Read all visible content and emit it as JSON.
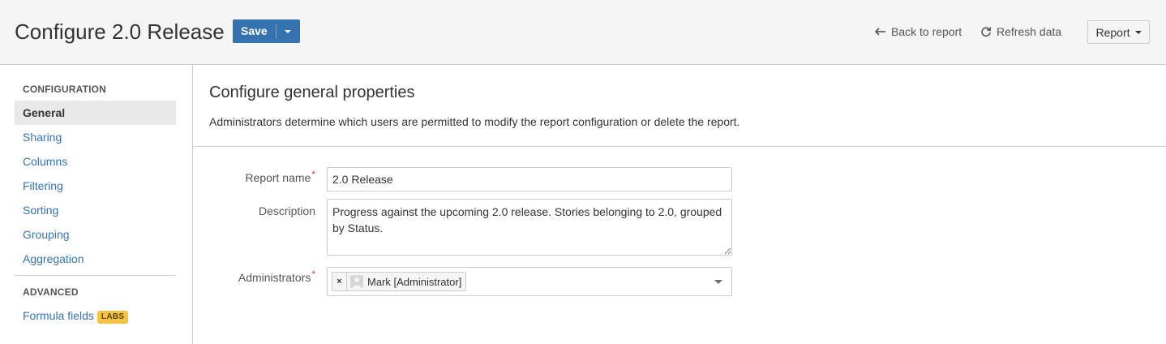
{
  "header": {
    "title": "Configure 2.0 Release",
    "save_label": "Save",
    "back_label": "Back to report",
    "refresh_label": "Refresh data",
    "report_label": "Report"
  },
  "sidebar": {
    "configuration_heading": "CONFIGURATION",
    "items": [
      {
        "label": "General",
        "active": true
      },
      {
        "label": "Sharing"
      },
      {
        "label": "Columns"
      },
      {
        "label": "Filtering"
      },
      {
        "label": "Sorting"
      },
      {
        "label": "Grouping"
      },
      {
        "label": "Aggregation"
      }
    ],
    "advanced_heading": "ADVANCED",
    "advanced_items": [
      {
        "label": "Formula fields",
        "badge": "LABS"
      }
    ]
  },
  "main": {
    "section_title": "Configure general properties",
    "section_description": "Administrators determine which users are permitted to modify the report configuration or delete the report.",
    "fields": {
      "report_name": {
        "label": "Report name",
        "required": "*",
        "value": "2.0 Release"
      },
      "description": {
        "label": "Description",
        "value": "Progress against the upcoming 2.0 release. Stories belonging to 2.0, grouped by Status."
      },
      "administrators": {
        "label": "Administrators",
        "required": "*",
        "chips": [
          {
            "remove": "×",
            "label": "Mark [Administrator]"
          }
        ]
      }
    }
  },
  "colors": {
    "primary": "#3572b0",
    "link": "#3572b0",
    "required": "#d04437",
    "labs_badge": "#f6c342",
    "header_bg": "#f5f5f5"
  }
}
